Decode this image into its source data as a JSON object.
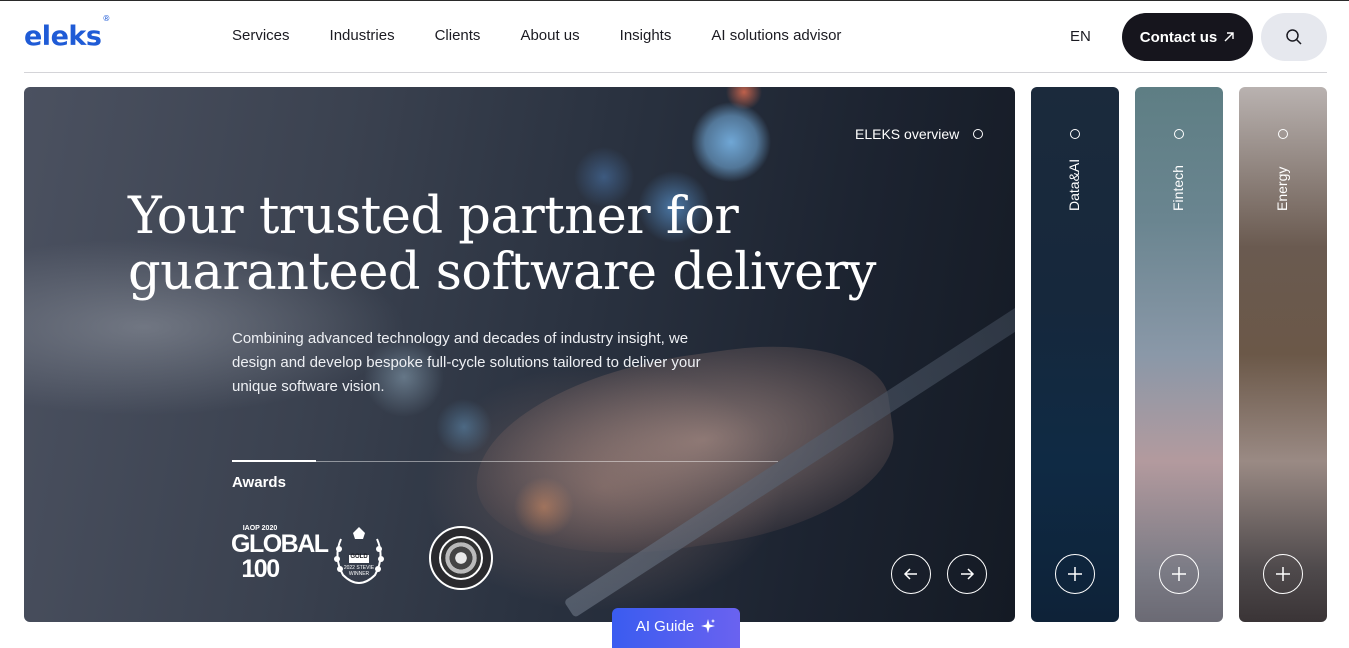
{
  "header": {
    "logo_text": "eleks",
    "logo_mark": "®",
    "nav": [
      "Services",
      "Industries",
      "Clients",
      "About us",
      "Insights",
      "AI solutions advisor"
    ],
    "lang": "EN",
    "contact_label": "Contact us",
    "search_icon": "search-icon"
  },
  "hero": {
    "overview_label": "ELEKS overview",
    "headline_line1": "Your trusted partner for",
    "headline_line2": "guaranteed software delivery",
    "subtext": "Combining advanced technology and decades of industry insight, we design and develop bespoke full-cycle solutions tailored to deliver your unique software vision.",
    "awards_label": "Awards",
    "awards": [
      {
        "top": "IAOP 2020",
        "main_line1": "GLOBAL",
        "main_line2": "100"
      },
      {
        "label": "GOLD",
        "caption": "2022 STEVIE WINNER"
      },
      {
        "label": "award-seal"
      }
    ]
  },
  "side_panels": [
    {
      "label": "Data&AI",
      "color": "#0f2a44"
    },
    {
      "label": "Fintech",
      "color": "#6a8590"
    },
    {
      "label": "Energy",
      "color": "#6b5848"
    }
  ],
  "ai_guide": {
    "label": "AI Guide",
    "icon": "sparkle-icon"
  },
  "colors": {
    "brand": "#1f5bd6",
    "contact_bg": "#16151d",
    "search_bg": "#e6e8ee",
    "ai_guide": "#4a5ef0"
  }
}
